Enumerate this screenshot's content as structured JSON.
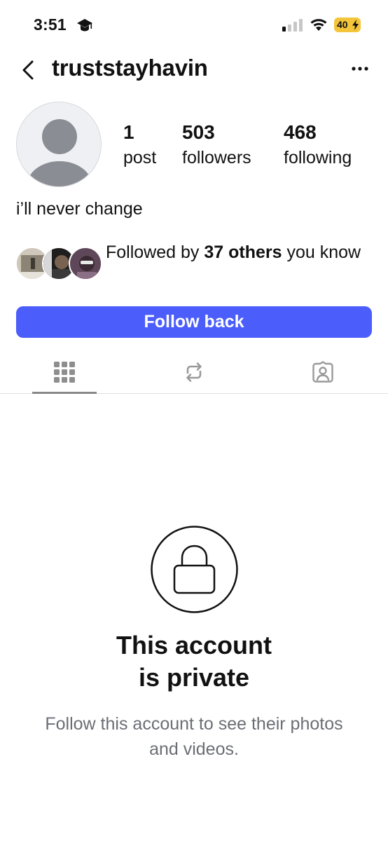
{
  "status_bar": {
    "time": "3:51",
    "battery": "40"
  },
  "header": {
    "username": "truststayhavin"
  },
  "profile": {
    "stats": [
      {
        "value": "1",
        "label": "post"
      },
      {
        "value": "503",
        "label": "followers"
      },
      {
        "value": "468",
        "label": "following"
      }
    ],
    "bio": "i’ll never change",
    "mutuals": {
      "prefix": "Followed by ",
      "count_text": "37 others",
      "suffix": " you know"
    },
    "follow_button": "Follow back"
  },
  "tabs": [
    {
      "icon": "grid-icon",
      "active": true
    },
    {
      "icon": "repost-icon",
      "active": false
    },
    {
      "icon": "tagged-icon",
      "active": false
    }
  ],
  "private": {
    "title_line1": "This account",
    "title_line2": "is private",
    "subtitle": "Follow this account to see their photos and videos."
  },
  "colors": {
    "accent": "#4b5dfa",
    "battery": "#f4c53b",
    "muted_text": "#6b6e75"
  }
}
